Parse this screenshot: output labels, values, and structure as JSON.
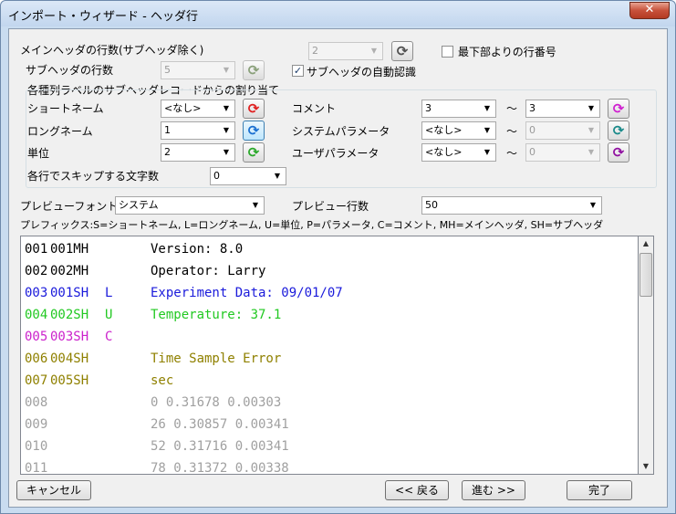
{
  "window": {
    "title": "インポート・ウィザード - ヘッダ行",
    "close": "✕"
  },
  "main_header_rows": {
    "label": "メインヘッダの行数(サブヘッダ除く)",
    "value": "2"
  },
  "sub_header_rows": {
    "label": "サブヘッダの行数",
    "value": "5"
  },
  "bottom_row_numbers": {
    "label": "最下部よりの行番号",
    "checked": false
  },
  "auto_detect_subheader": {
    "label": "サブヘッダの自動認識",
    "checked": true,
    "mark": "✓"
  },
  "assign_group": {
    "title": "各種列ラベルのサブヘッダレコードからの割り当て"
  },
  "short_name": {
    "label": "ショートネーム",
    "value": "<なし>"
  },
  "long_name": {
    "label": "ロングネーム",
    "value": "1"
  },
  "unit": {
    "label": "単位",
    "value": "2"
  },
  "comment": {
    "label": "コメント",
    "from": "3",
    "to": "3"
  },
  "system_param": {
    "label": "システムパラメータ",
    "from": "<なし>",
    "to": "0"
  },
  "user_param": {
    "label": "ユーザパラメータ",
    "from": "<なし>",
    "to": "0"
  },
  "tilde": "〜",
  "skip_chars": {
    "label": "各行でスキップする文字数",
    "value": "0"
  },
  "preview_font": {
    "label": "プレビューフォント",
    "value": "システム"
  },
  "preview_rows": {
    "label": "プレビュー行数",
    "value": "50"
  },
  "prefix_legend": "プレフィックス:S=ショートネーム, L=ロングネーム, U=単位, P=パラメータ, C=コメント, MH=メインヘッダ, SH=サブヘッダ",
  "preview_lines": [
    {
      "num": "001",
      "tag": "001MH",
      "code": "",
      "text": "Version: 8.0",
      "color": "#000000"
    },
    {
      "num": "002",
      "tag": "002MH",
      "code": "",
      "text": "Operator: Larry",
      "color": "#000000"
    },
    {
      "num": "003",
      "tag": "001SH",
      "code": "L",
      "text": "Experiment Data: 09/01/07",
      "color": "#1a1adb"
    },
    {
      "num": "004",
      "tag": "002SH",
      "code": "U",
      "text": "Temperature: 37.1",
      "color": "#22c922"
    },
    {
      "num": "005",
      "tag": "003SH",
      "code": "C",
      "text": "",
      "color": "#cc22cc"
    },
    {
      "num": "006",
      "tag": "004SH",
      "code": "",
      "text": "Time Sample Error",
      "color": "#8f8000"
    },
    {
      "num": "007",
      "tag": "005SH",
      "code": "",
      "text": "sec",
      "color": "#8f8000"
    },
    {
      "num": "008",
      "tag": "",
      "code": "",
      "text": "0 0.31678 0.00303",
      "color": "#a0a0a0"
    },
    {
      "num": "009",
      "tag": "",
      "code": "",
      "text": "26 0.30857 0.00341",
      "color": "#a0a0a0"
    },
    {
      "num": "010",
      "tag": "",
      "code": "",
      "text": "52 0.31716 0.00341",
      "color": "#a0a0a0"
    },
    {
      "num": "011",
      "tag": "",
      "code": "",
      "text": "78 0.31372 0.00338",
      "color": "#a0a0a0"
    }
  ],
  "buttons": {
    "cancel": "キャンセル",
    "back": "<< 戻る",
    "next": "進む >>",
    "finish": "完了"
  },
  "icons": {
    "refresh": "⟳"
  },
  "colors": {
    "red_icon": "#e02020",
    "blue_icon": "#1a6fd0",
    "green_icon": "#2aa82a",
    "magenta_icon": "#d020d0",
    "purple_icon": "#9010a0",
    "gray_icon": "#8aa07a"
  }
}
